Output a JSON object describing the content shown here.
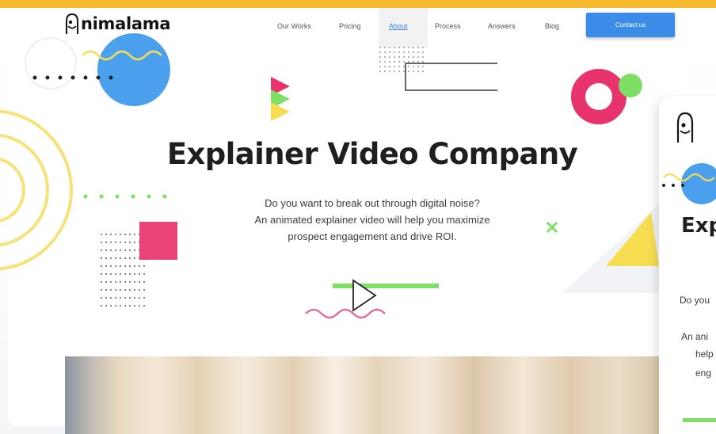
{
  "brand": {
    "logo_text": "nimalama",
    "logo_icon": "llama-head-icon"
  },
  "nav": {
    "items": [
      {
        "label": "Our Works",
        "active": false
      },
      {
        "label": "Pricing",
        "active": false
      },
      {
        "label": "About",
        "active": true
      },
      {
        "label": "Process",
        "active": false
      },
      {
        "label": "Answers",
        "active": false
      },
      {
        "label": "Blog",
        "active": false
      }
    ],
    "contact_label": "Contact us"
  },
  "hero": {
    "title": "Explainer Video Company",
    "subtitle_lines": [
      "Do you want to break out through digital noise?",
      "An animated explainer video will  help you maximize",
      "prospect engagement and drive ROI."
    ],
    "play_icon": "play-icon"
  },
  "side_preview": {
    "title_fragment": "Exp",
    "lines": [
      "Do you",
      "An ani",
      "help",
      "eng"
    ]
  },
  "colors": {
    "frame": "#f6b82d",
    "accent_blue": "#3b8ce8",
    "pink": "#e8336d",
    "green": "#7ddf64",
    "yellow": "#f7dd50"
  }
}
